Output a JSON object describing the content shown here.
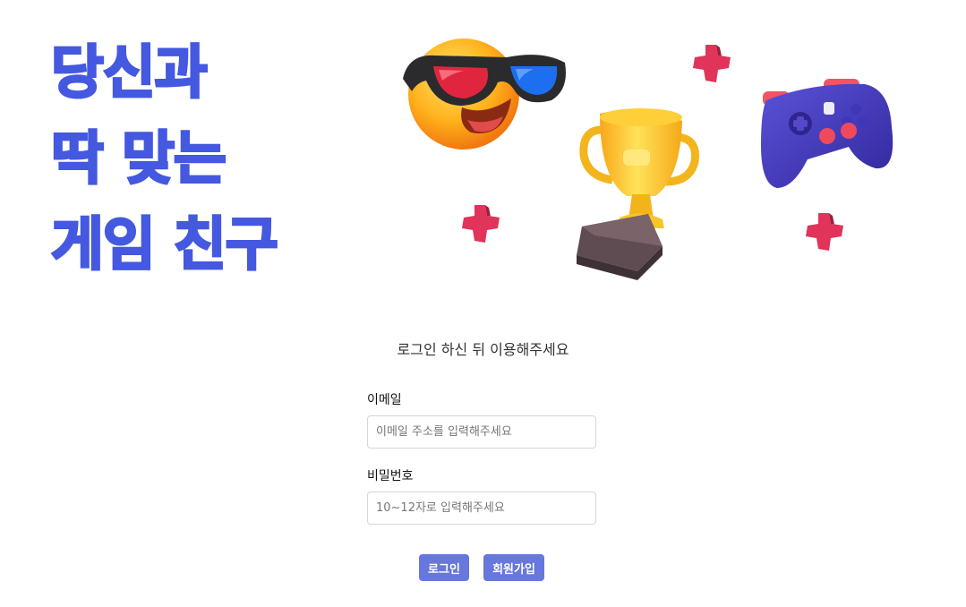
{
  "hero": {
    "headline_line1": "당신과",
    "headline_line2": "딱 맞는",
    "headline_line3": "게임 친구"
  },
  "illustration": {
    "items": [
      "sunglasses-emoji-icon",
      "trophy-icon",
      "gamepad-icon",
      "plus-icon",
      "plus-icon",
      "plus-icon",
      "plus-icon"
    ]
  },
  "login": {
    "message": "로그인 하신 뒤 이용해주세요",
    "email_label": "이메일",
    "email_placeholder": "이메일 주소를 입력해주세요",
    "password_label": "비밀번호",
    "password_placeholder": "10~12자로 입력해주세요",
    "login_button": "로그인",
    "signup_button": "회원가입"
  },
  "colors": {
    "headline": "#4458e0",
    "button": "#6777dc",
    "plus": "#e0345a",
    "gamepad": "#4a3fc4",
    "trophy": "#f5c21b"
  }
}
